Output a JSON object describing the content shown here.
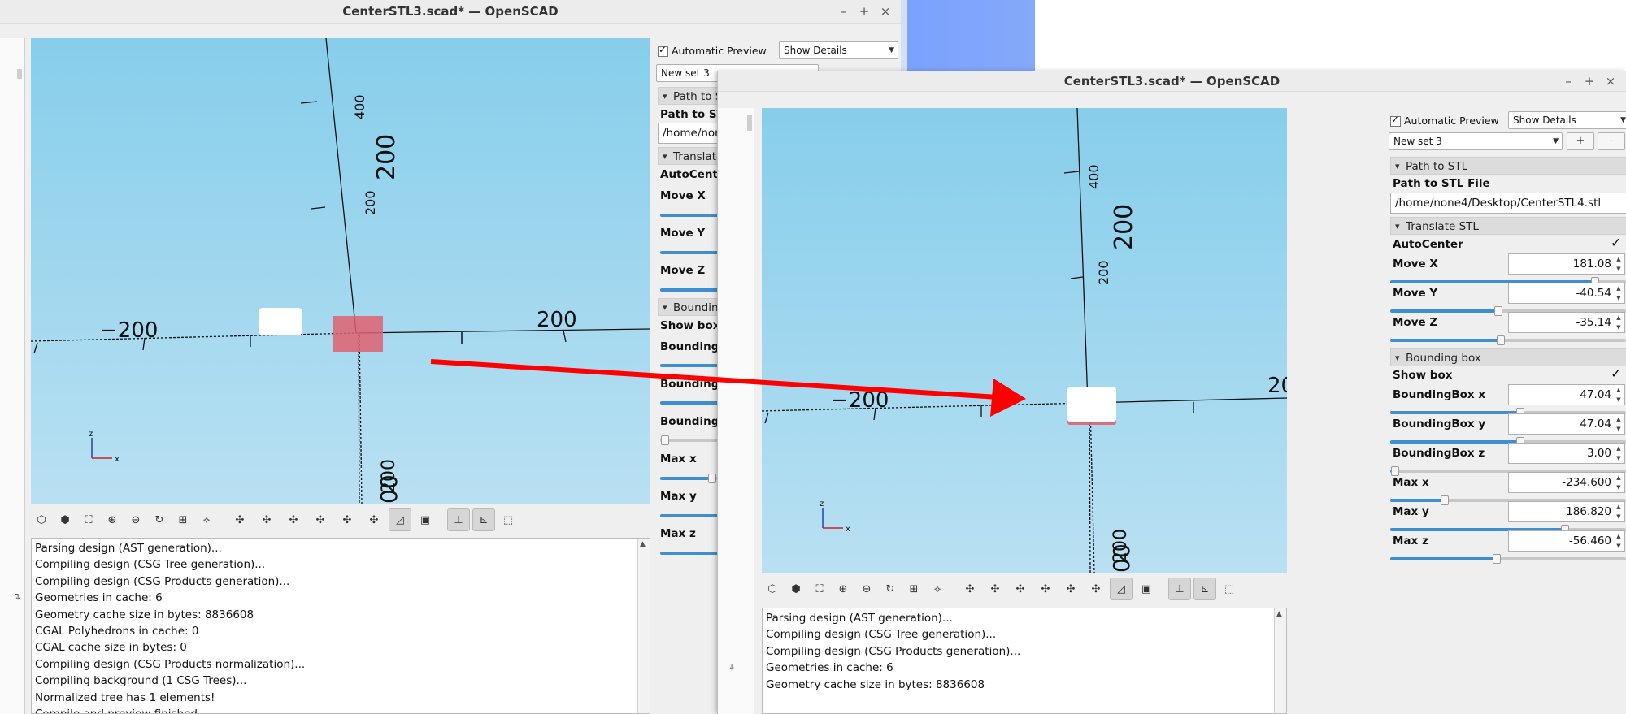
{
  "colors": {
    "accent": "#3d8fd1",
    "arrow": "#ff0000",
    "sky_top": "#87ceeb",
    "sky_bottom": "#b9e0f2",
    "box_red": "#e06070"
  },
  "window_buttons": [
    "–",
    "+",
    "×"
  ],
  "console_lines": [
    "Parsing design (AST generation)...",
    "Compiling design (CSG Tree generation)...",
    "Compiling design (CSG Products generation)...",
    "Geometries in cache: 6",
    "Geometry cache size in bytes: 8836608",
    "CGAL Polyhedrons in cache: 0",
    "CGAL cache size in bytes: 0",
    "Compiling design (CSG Products normalization)...",
    "Compiling background (1 CSG Trees)...",
    "Normalized tree has 1 elements!",
    "Compile and preview finished."
  ],
  "toolbar_icons": [
    "preview-icon",
    "render-icon",
    "view-all-icon",
    "zoom-in-icon",
    "zoom-out-icon",
    "reset-view-icon",
    "show-axes-icon",
    "show-edges-icon",
    "view-right-icon",
    "view-top-icon",
    "view-bottom-icon",
    "view-left-icon",
    "view-front-icon",
    "view-back-icon",
    "perspective-icon",
    "orthogonal-icon",
    "show-axes-toggle-icon",
    "show-scale-icon",
    "show-crosshair-icon"
  ],
  "axes": {
    "x_neg_label": "−200",
    "x_pos_label": "200",
    "z_label_big": "200",
    "z_label_small": "200",
    "z_label_400": "400",
    "neg_z_label": "200",
    "neg_z_suffix": "00",
    "mini_z": "z",
    "mini_x": "x"
  },
  "win1": {
    "title": "CenterSTL3.scad* — OpenSCAD",
    "auto_preview": "Automatic Preview",
    "show_details": "Show Details",
    "set_name": "New set 3",
    "group_path": "Path to S",
    "label_path": "Path to ST",
    "path_value": "/home/non",
    "group_translate": "Translate",
    "label_autocenter": "AutoCente",
    "label_move_x": "Move X",
    "label_move_y": "Move Y",
    "label_move_z": "Move Z",
    "group_bounding": "Boundin",
    "label_show_box": "Show box",
    "label_bb1": "Boundingl",
    "label_bb2": "Boundingl",
    "label_bb3": "Boundingl",
    "label_max_x": "Max x",
    "label_max_y": "Max y",
    "label_max_z": "Max z"
  },
  "win2": {
    "title": "CenterSTL3.scad* — OpenSCAD",
    "auto_preview": "Automatic Preview",
    "show_details": "Show Details",
    "set_name": "New set 3",
    "plus": "+",
    "minus": "-",
    "group_path": "Path to STL",
    "label_path": "Path to STL File",
    "path_value": "/home/none4/Desktop/CenterSTL4.stl",
    "group_translate": "Translate STL",
    "label_autocenter": "AutoCenter",
    "params": [
      {
        "label": "Move X",
        "value": "181.08",
        "slider": 0.87
      },
      {
        "label": "Move Y",
        "value": "-40.54",
        "slider": 0.46
      },
      {
        "label": "Move Z",
        "value": "-35.14",
        "slider": 0.47
      }
    ],
    "group_bounding": "Bounding box",
    "label_show_box": "Show box",
    "params2": [
      {
        "label": "BoundingBox x",
        "value": "47.04",
        "slider": 0.55
      },
      {
        "label": "BoundingBox y",
        "value": "47.04",
        "slider": 0.55
      },
      {
        "label": "BoundingBox z",
        "value": "3.00",
        "slider": 0.02
      },
      {
        "label": "Max x",
        "value": "-234.600",
        "slider": 0.23
      },
      {
        "label": "Max y",
        "value": "186.820",
        "slider": 0.74
      },
      {
        "label": "Max z",
        "value": "-56.460",
        "slider": 0.45
      }
    ]
  }
}
